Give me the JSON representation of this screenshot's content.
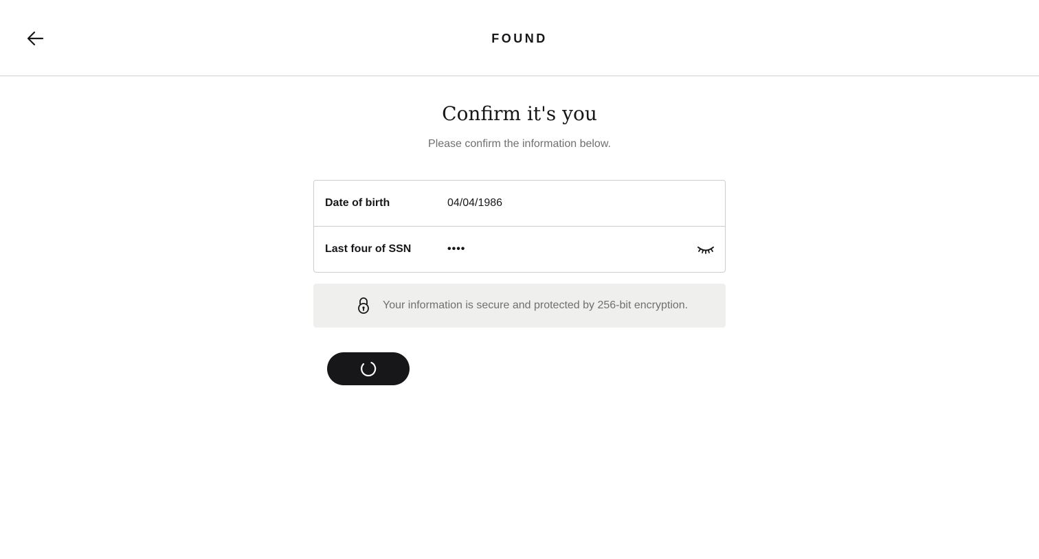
{
  "header": {
    "brand": "FOUND",
    "back_icon": "arrow-left-icon"
  },
  "main": {
    "title": "Confirm it's you",
    "subtitle": "Please confirm the information below."
  },
  "form": {
    "dob_label": "Date of birth",
    "dob_value": "04/04/1986",
    "ssn_label": "Last four of SSN",
    "ssn_masked": "••••",
    "ssn_toggle_icon": "eye-closed-icon"
  },
  "security_note": {
    "icon": "lock-icon",
    "text": "Your information is secure and protected by 256-bit encryption."
  },
  "submit": {
    "state": "loading",
    "icon": "spinner-icon"
  },
  "colors": {
    "text_primary": "#17171a",
    "text_muted": "#6f6f6f",
    "button_bg": "#17171a",
    "note_bg": "#eff0ee",
    "border": "#cccccc"
  }
}
